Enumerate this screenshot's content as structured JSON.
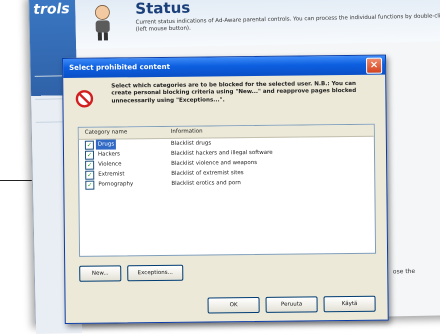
{
  "app": {
    "sidebar_title": "trols",
    "header": {
      "title": "Status",
      "description": "Current status indications of Ad-Aware parental controls. You can process the individual functions by double-clicking (left mouse button)."
    },
    "bottom_text": "ose the"
  },
  "dialog": {
    "title": "Select prohibited content",
    "close_glyph": "×",
    "message": "Select which categories are to be blocked for the selected user. N.B.: You can create personal blocking criteria using \"New...\" and reapprove pages blocked unnecessarily using \"Exceptions...\".",
    "columns": {
      "name": "Category name",
      "info": "Information"
    },
    "rows": [
      {
        "name": "Drugs",
        "info": "Blacklist drugs",
        "checked": "✓"
      },
      {
        "name": "Hackers",
        "info": "Blacklist hackers and illegal software",
        "checked": "✓"
      },
      {
        "name": "Violence",
        "info": "Blacklist violence and weapons",
        "checked": "✓"
      },
      {
        "name": "Extremist",
        "info": "Blacklist of extremist sites",
        "checked": "✓"
      },
      {
        "name": "Pornography",
        "info": "Blacklist erotics and porn",
        "checked": "✓"
      }
    ],
    "buttons": {
      "new": "New...",
      "exceptions": "Exceptions...",
      "ok": "OK",
      "cancel": "Peruuta",
      "apply": "Käytä"
    }
  },
  "colors": {
    "titlebar": "#0d5fe0",
    "selection": "#316ac5",
    "dialog_bg": "#ece9d8"
  }
}
